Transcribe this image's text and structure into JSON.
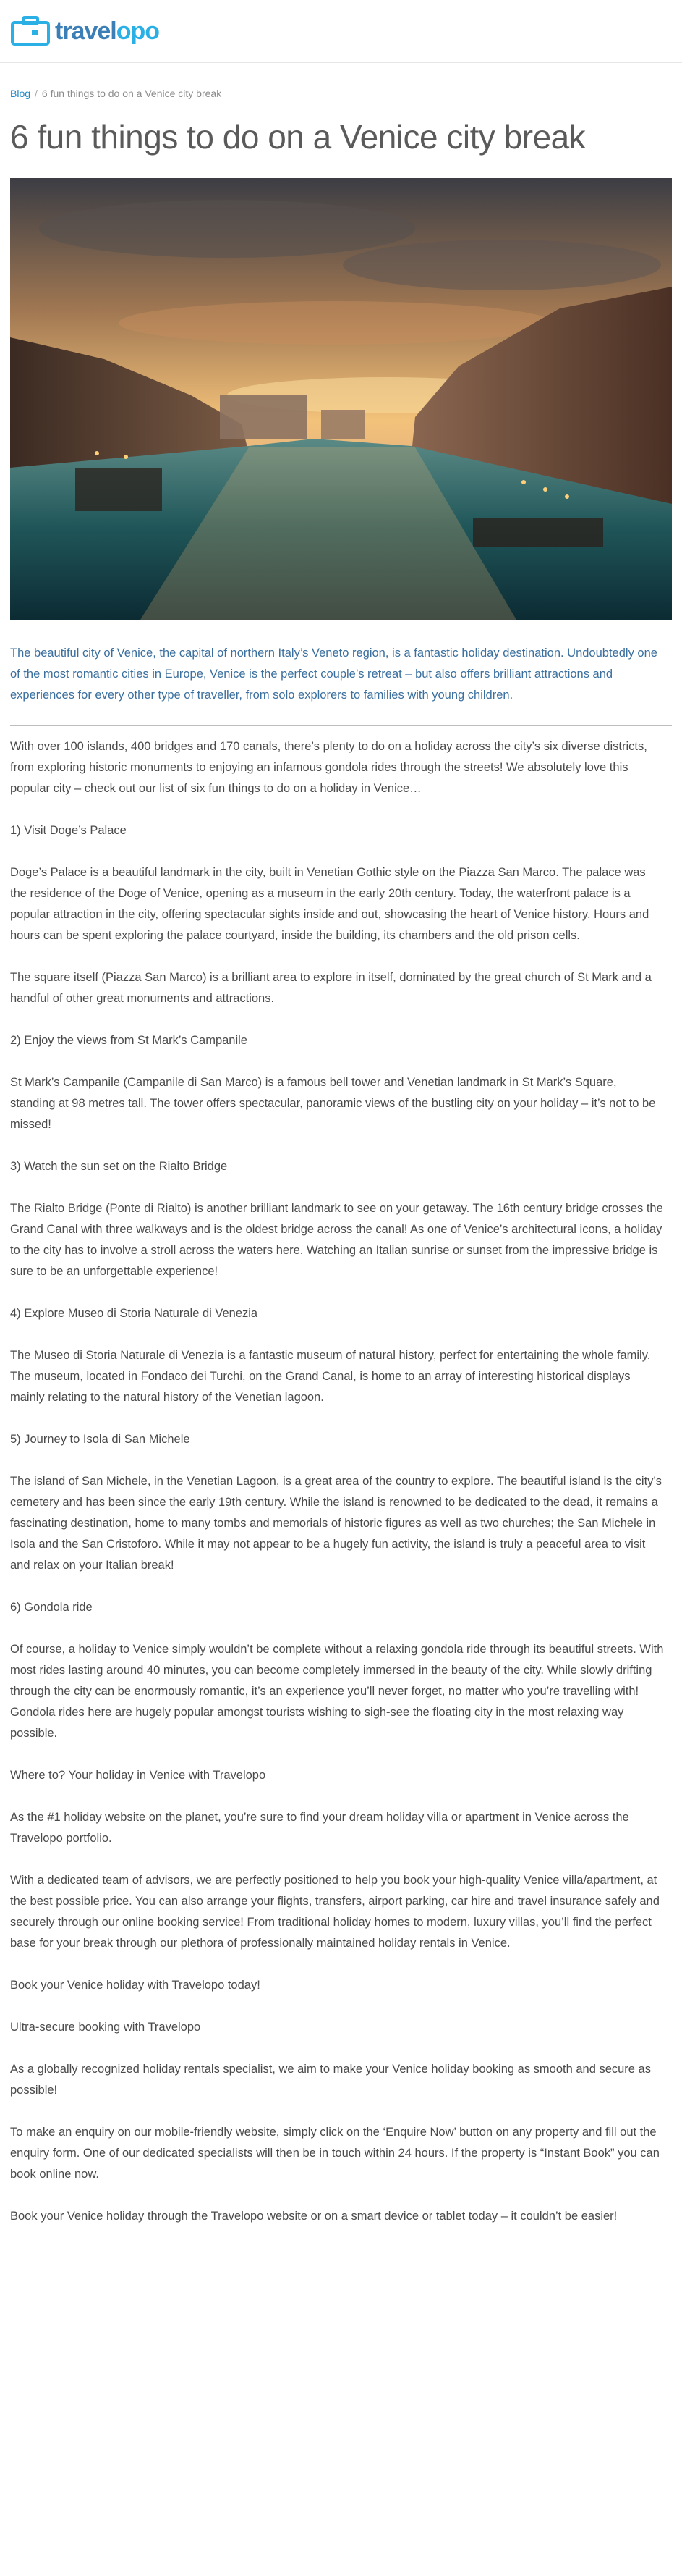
{
  "header": {
    "logo_part1": "travel",
    "logo_part2": "opo"
  },
  "breadcrumb": {
    "link": "Blog",
    "separator": "/",
    "current": "6 fun things to do on a Venice city break"
  },
  "title": "6 fun things to do on a Venice city break",
  "hero": {
    "alt": "Venice Grand Canal at sunset"
  },
  "intro": "The beautiful city of Venice, the capital of northern Italy’s Veneto region, is a fantastic holiday destination. Undoubtedly one of the most romantic cities in Europe, Venice is the perfect couple’s retreat – but also offers brilliant attractions and experiences for every other type of traveller, from solo explorers to families with young children.",
  "body": [
    "With over 100 islands, 400 bridges and 170 canals, there’s plenty to do on a holiday across the city’s six diverse districts, from exploring historic monuments to enjoying an infamous gondola rides through the streets! We absolutely love this popular city – check out our list of six fun things to do on a holiday in Venice…",
    "1) Visit Doge’s Palace",
    "Doge’s Palace is a beautiful landmark in the city, built in Venetian Gothic style on the Piazza San Marco. The palace was the residence of the Doge of Venice, opening as a museum in the early 20th century. Today, the waterfront palace is a popular attraction in the city, offering spectacular sights inside and out, showcasing the heart of Venice history. Hours and hours can be spent exploring the palace courtyard, inside the building, its chambers and the old prison cells.",
    "The square itself (Piazza San Marco) is a brilliant area to explore in itself, dominated by the great church of St Mark and a handful of other great monuments and attractions.",
    "2) Enjoy the views from St Mark’s Campanile",
    "St Mark’s Campanile (Campanile di San Marco) is a famous bell tower and Venetian landmark in St Mark’s Square, standing at 98 metres tall. The tower offers spectacular, panoramic views of the bustling city on your holiday – it’s not to be missed!",
    "3) Watch the sun set on the Rialto Bridge",
    "The Rialto Bridge (Ponte di Rialto) is another brilliant landmark to see on your getaway. The 16th century bridge crosses the Grand Canal with three walkways and is the oldest bridge across the canal! As one of Venice’s architectural icons, a holiday to the city has to involve a stroll across the waters here. Watching an Italian sunrise or sunset from the impressive bridge is sure to be an unforgettable experience!",
    "4) Explore Museo di Storia Naturale di Venezia",
    "The Museo di Storia Naturale di Venezia is a fantastic museum of natural history, perfect for entertaining the whole family. The museum, located in Fondaco dei Turchi, on the Grand Canal, is home to an array of interesting historical displays mainly relating to the natural history of the Venetian lagoon.",
    "5) Journey to Isola di San Michele",
    "The island of San Michele, in the Venetian Lagoon, is a great area of the country to explore. The beautiful island is the city’s cemetery and has been since the early 19th century. While the island is renowned to be dedicated to the dead, it remains a fascinating destination, home to many tombs and memorials of historic figures as well as two churches; the San Michele in Isola and the San Cristoforo. While it may not appear to be a hugely fun activity, the island is truly a peaceful area to visit and relax on your Italian break!",
    "6) Gondola ride",
    "Of course, a holiday to Venice simply wouldn’t be complete without a relaxing gondola ride through its beautiful streets. With most rides lasting around 40 minutes, you can become completely immersed in the beauty of the city. While slowly drifting through the city can be enormously romantic, it’s an experience you’ll never forget, no matter who you’re travelling with! Gondola rides here are hugely popular amongst tourists wishing to sigh-see the floating city in the most relaxing way possible.",
    "Where to? Your holiday in Venice with Travelopo",
    "As the #1 holiday website on the planet, you’re sure to find your dream holiday villa or apartment in Venice across the Travelopo portfolio.",
    "With a dedicated team of advisors, we are perfectly positioned to help you book your high-quality Venice villa/apartment, at the best possible price. You can also arrange your flights, transfers, airport parking, car hire and travel insurance safely and securely through our online booking service! From traditional holiday homes to modern, luxury villas, you’ll find the perfect base for your break through our plethora of professionally maintained holiday rentals in Venice.",
    "Book your Venice holiday with Travelopo today!",
    "Ultra-secure booking with Travelopo",
    "As a globally recognized holiday rentals specialist, we aim to make your Venice holiday booking as smooth and secure as possible!",
    "To make an enquiry on our mobile-friendly website, simply click on the ‘Enquire Now’ button on any property and fill out the enquiry form. One of our dedicated specialists will then be in touch within 24 hours. If the property is “Instant Book” you can book online now.",
    "Book your Venice holiday through the Travelopo website or on a smart device or tablet today – it couldn’t be easier!"
  ]
}
